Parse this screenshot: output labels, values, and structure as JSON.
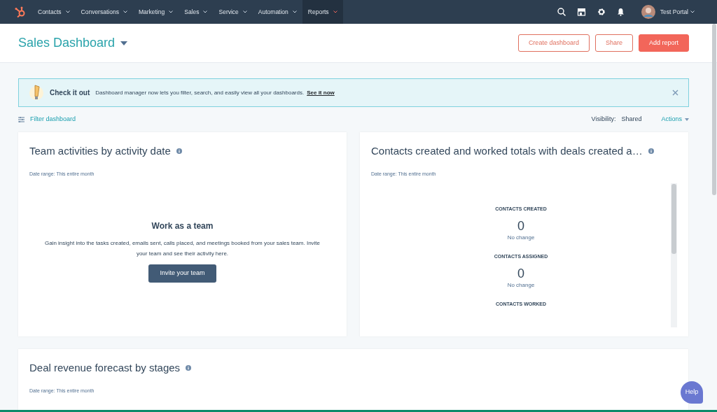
{
  "nav": {
    "items": [
      {
        "label": "Contacts",
        "selected": false
      },
      {
        "label": "Conversations",
        "selected": false
      },
      {
        "label": "Marketing",
        "selected": false
      },
      {
        "label": "Sales",
        "selected": false
      },
      {
        "label": "Service",
        "selected": false
      },
      {
        "label": "Automation",
        "selected": false
      },
      {
        "label": "Reports",
        "selected": true
      }
    ],
    "user": "Test Portal"
  },
  "header": {
    "title": "Sales Dashboard",
    "buttons": [
      {
        "label": "Create dashboard",
        "kind": "outline"
      },
      {
        "label": "Share",
        "kind": "outline"
      },
      {
        "label": "Add report",
        "kind": "primary"
      }
    ]
  },
  "banner": {
    "title": "Check it out",
    "message": "Dashboard manager now lets you filter, search, and easily view all your dashboards.",
    "link": "See it now"
  },
  "toolbar": {
    "filter": "Filter dashboard",
    "visibility_label": "Visibility:",
    "visibility_value": "Shared",
    "actions": "Actions"
  },
  "reports": [
    {
      "kind": "empty",
      "title": "Team activities by activity date",
      "date_range": "Date range: This entire month",
      "empty_title": "Work as a team",
      "empty_text": "Gain insight into the tasks created, emails sent, calls placed, and meetings booked from your sales team. Invite your team and see their activity here.",
      "button": "Invite your team"
    },
    {
      "kind": "metrics",
      "title": "Contacts created and worked totals with deals created a…",
      "date_range": "Date range: This entire month",
      "metrics": [
        {
          "label": "CONTACTS CREATED",
          "value": "0",
          "change": "No change"
        },
        {
          "label": "CONTACTS ASSIGNED",
          "value": "0",
          "change": "No change"
        },
        {
          "label": "CONTACTS WORKED"
        }
      ]
    },
    {
      "kind": "blank",
      "title": "Deal revenue forecast by stages",
      "date_range": "Date range: This entire month"
    }
  ],
  "help": "Help"
}
